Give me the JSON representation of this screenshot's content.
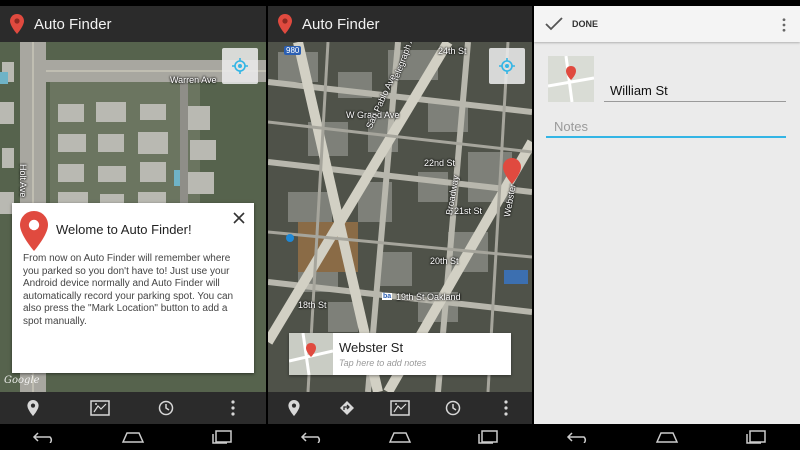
{
  "app": {
    "title": "Auto Finder"
  },
  "panel1": {
    "map_labels": {
      "warren_ave": "Warren Ave",
      "holt_ave": "Holt Ave"
    },
    "google": "Google",
    "welcome": {
      "title": "Welome to Auto Finder!",
      "body": "From now on Auto Finder will remember where you parked so you don't have to! Just use your Android device normally and Auto Finder will automatically record your parking spot. You can also press the \"Mark Location\" button to add a spot manually."
    }
  },
  "panel2": {
    "map_labels": {
      "hwy": "980",
      "w24": "24th St",
      "w_grand": "W Grand Ave",
      "telegraph": "Telegraph Ave",
      "san_pablo": "San Pablo Ave",
      "s22": "22nd St",
      "s21": "21st St",
      "s20": "20th St",
      "s18": "18th St",
      "broadway": "Broadway",
      "webster": "Webster",
      "bart": "19th St Oakland",
      "bart_logo": "ba"
    },
    "card": {
      "street": "Webster St",
      "hint": "Tap here to add notes"
    }
  },
  "panel3": {
    "done_label": "DONE",
    "street_value": "William St",
    "notes_placeholder": "Notes"
  },
  "icons": {
    "pin": "map-pin-icon",
    "locate": "crosshair-icon",
    "map": "map-icon",
    "history": "clock-icon",
    "directions": "directions-icon",
    "overflow": "overflow-menu-icon",
    "back": "back-icon",
    "home": "home-icon",
    "recents": "recents-icon",
    "check": "checkmark-icon",
    "close": "close-icon"
  },
  "colors": {
    "actionbar": "#2b2b2b",
    "pin_red": "#e04a3f",
    "holo_blue": "#33b5e5",
    "dialog_bg": "#ffffff"
  }
}
